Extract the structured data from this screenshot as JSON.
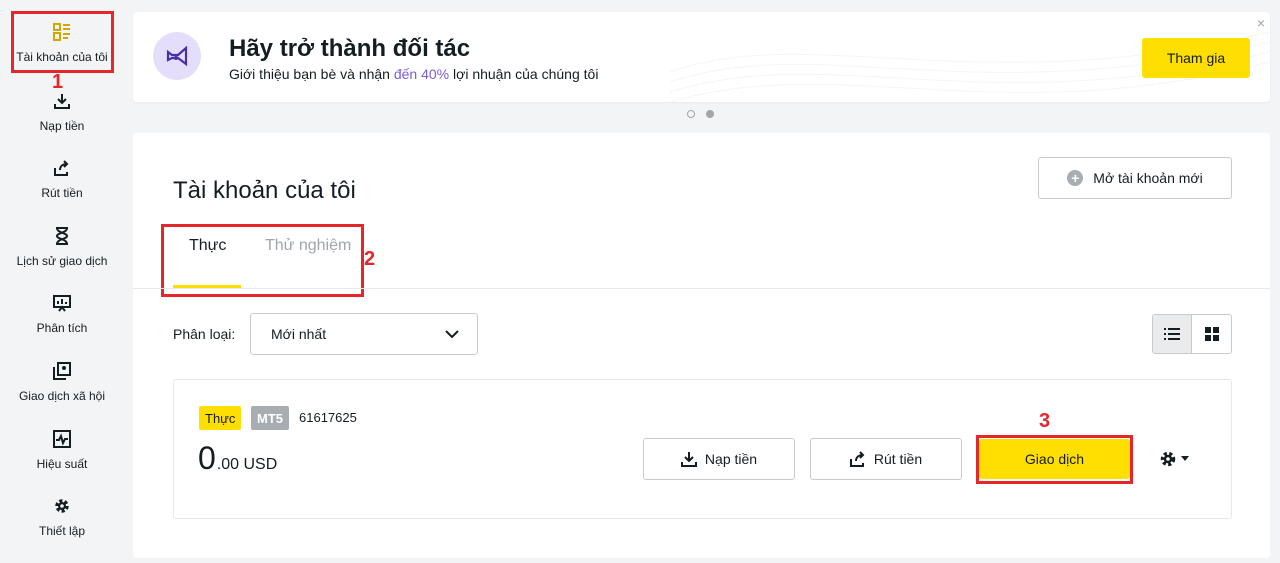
{
  "sidebar": {
    "items": [
      {
        "label": "Tài khoản của tôi",
        "icon": "dashboard-icon"
      },
      {
        "label": "Nạp tiền",
        "icon": "deposit-icon"
      },
      {
        "label": "Rút tiền",
        "icon": "withdraw-icon"
      },
      {
        "label": "Lịch sử giao dịch",
        "icon": "hourglass-icon"
      },
      {
        "label": "Phân tích",
        "icon": "analytics-icon"
      },
      {
        "label": "Giao dịch xã hội",
        "icon": "social-trading-icon"
      },
      {
        "label": "Hiệu suất",
        "icon": "performance-icon"
      },
      {
        "label": "Thiết lập",
        "icon": "gear-icon"
      }
    ]
  },
  "annotations": {
    "step1": "1",
    "step2": "2",
    "step3": "3"
  },
  "banner": {
    "title": "Hãy trở thành đối tác",
    "subtitle_prefix": "Giới thiệu bạn bè và nhận",
    "subtitle_accent": "đến 40%",
    "subtitle_suffix": "lợi nhuận của chúng tôi",
    "join_label": "Tham gia",
    "close": "×"
  },
  "main": {
    "title": "Tài khoản của tôi",
    "open_account_label": "Mở tài khoản mới",
    "tabs": [
      {
        "label": "Thực"
      },
      {
        "label": "Thử nghiệm"
      }
    ],
    "sort_label": "Phân loại:",
    "sort_value": "Mới nhất"
  },
  "account": {
    "type_badge": "Thực",
    "platform_badge": "MT5",
    "number": "61617625",
    "balance_int": "0",
    "balance_dec": ".00 USD",
    "deposit_label": "Nạp tiền",
    "withdraw_label": "Rút tiền",
    "trade_label": "Giao dịch"
  },
  "colors": {
    "accent_yellow": "#ffde02",
    "annotation_red": "#e5262b",
    "banner_accent": "#7a5cd8"
  }
}
